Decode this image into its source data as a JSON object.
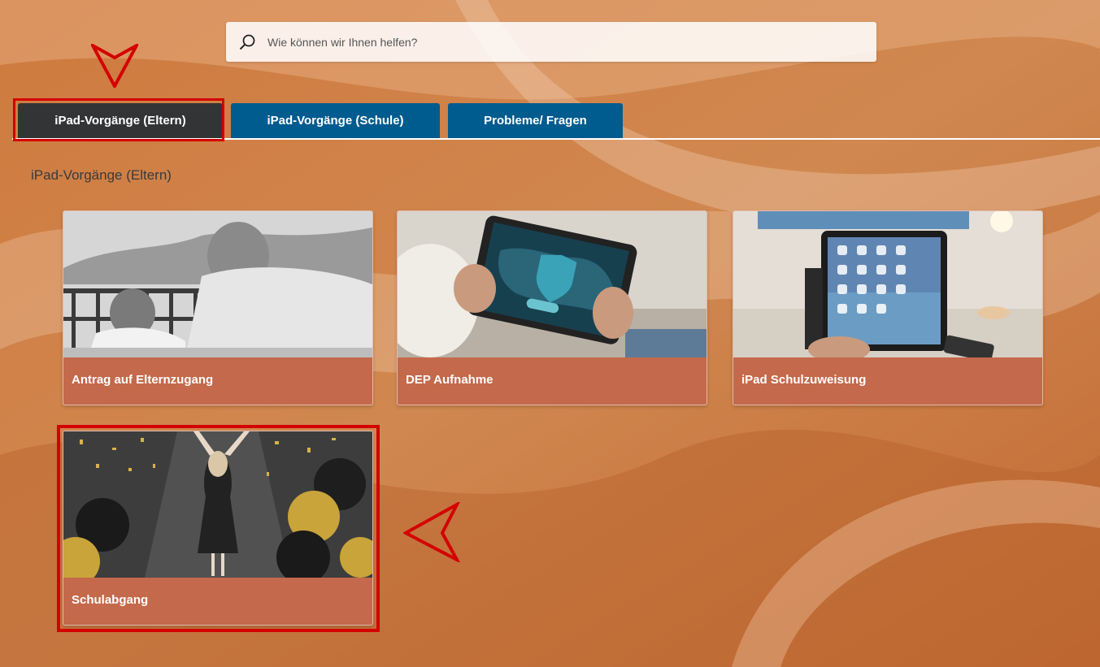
{
  "search": {
    "placeholder": "Wie können wir Ihnen helfen?",
    "icon": "search-icon"
  },
  "tabs": [
    {
      "label": "iPad-Vorgänge (Eltern)",
      "active": true
    },
    {
      "label": "iPad-Vorgänge (Schule)",
      "active": false
    },
    {
      "label": "Probleme/ Fragen",
      "active": false
    }
  ],
  "section": {
    "title": "iPad-Vorgänge (Eltern)"
  },
  "cards": [
    {
      "label": "Antrag auf Elternzugang"
    },
    {
      "label": "DEP Aufnahme"
    },
    {
      "label": "iPad Schulzuweisung"
    },
    {
      "label": "Schulabgang"
    }
  ],
  "colors": {
    "background": "#c8763f",
    "tab_active": "#333435",
    "tab_inactive": "#005b8f",
    "card": "#c4694b",
    "highlight": "#d40000"
  }
}
